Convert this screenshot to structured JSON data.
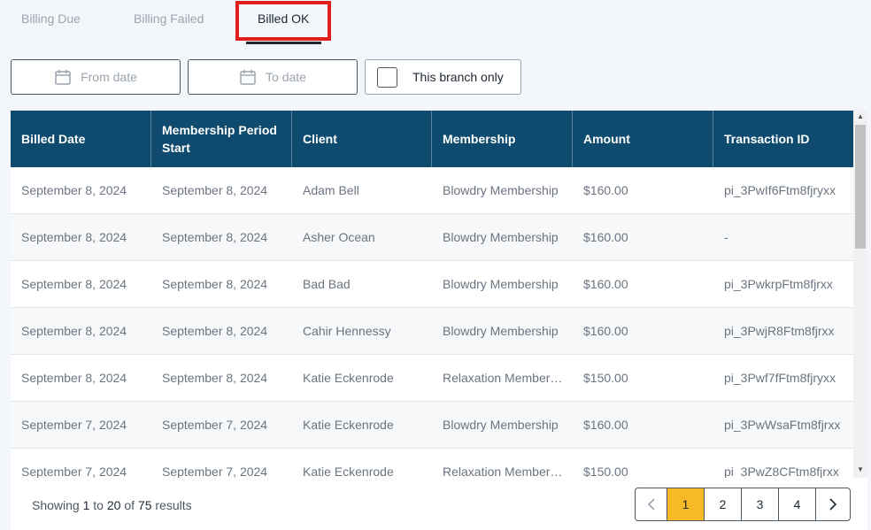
{
  "tabs": [
    {
      "label": "Billing Due"
    },
    {
      "label": "Billing Failed"
    },
    {
      "label": "Billed OK"
    }
  ],
  "filters": {
    "from_placeholder": "From date",
    "to_placeholder": "To date",
    "branch_label": "This branch only"
  },
  "table": {
    "headers": [
      "Billed Date",
      "Membership Period Start",
      "Client",
      "Membership",
      "Amount",
      "Transaction ID"
    ],
    "rows": [
      [
        "September 8, 2024",
        "September 8, 2024",
        "Adam Bell",
        "Blowdry Membership",
        "$160.00",
        "pi_3PwIf6Ftm8fjryxx"
      ],
      [
        "September 8, 2024",
        "September 8, 2024",
        "Asher Ocean",
        "Blowdry Membership",
        "$160.00",
        "-"
      ],
      [
        "September 8, 2024",
        "September 8, 2024",
        "Bad Bad",
        "Blowdry Membership",
        "$160.00",
        "pi_3PwkrpFtm8fjrxx"
      ],
      [
        "September 8, 2024",
        "September 8, 2024",
        "Cahir Hennessy",
        "Blowdry Membership",
        "$160.00",
        "pi_3PwjR8Ftm8fjrxx"
      ],
      [
        "September 8, 2024",
        "September 8, 2024",
        "Katie Eckenrode",
        "Relaxation Membership",
        "$150.00",
        "pi_3Pwf7fFtm8fjryxx"
      ],
      [
        "September 7, 2024",
        "September 7, 2024",
        "Katie Eckenrode",
        "Blowdry Membership",
        "$160.00",
        "pi_3PwWsaFtm8fjrxx"
      ],
      [
        "September 7, 2024",
        "September 7, 2024",
        "Katie Eckenrode",
        "Relaxation Membership",
        "$150.00",
        "pi_3PwZ8CFtm8fjrxx"
      ]
    ]
  },
  "footer": {
    "showing_prefix": "Showing",
    "from": "1",
    "to_word": "to",
    "to": "20",
    "of_word": "of",
    "total": "75",
    "suffix": "results"
  },
  "pagination": {
    "pages": [
      "1",
      "2",
      "3",
      "4"
    ],
    "active": "1",
    "prev_icon": "chevron-left-icon",
    "next_icon": "chevron-right-icon"
  },
  "colors": {
    "header_bg": "#0e4b6e",
    "active_page": "#f7b924",
    "highlight": "#e01e1e"
  }
}
